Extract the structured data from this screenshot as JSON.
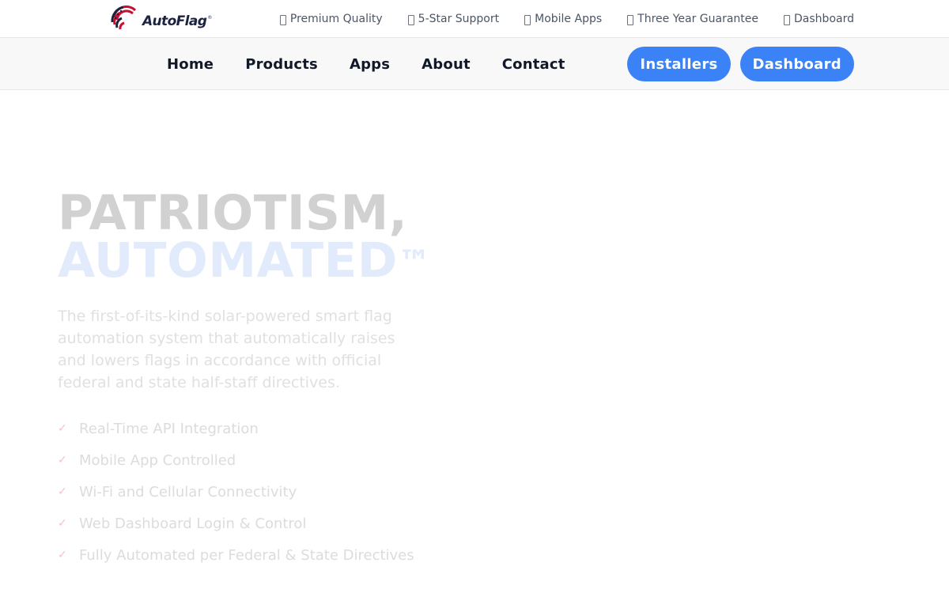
{
  "brand": {
    "name": "AutoFlag",
    "mark": "®"
  },
  "utility_nav": [
    {
      "label": "Premium Quality",
      "icon": "badge-icon"
    },
    {
      "label": "5-Star Support",
      "icon": "headset-icon"
    },
    {
      "label": "Mobile Apps",
      "icon": "phone-icon"
    },
    {
      "label": "Three Year Guarantee",
      "icon": "shield-icon"
    },
    {
      "label": "Dashboard",
      "icon": "dashboard-icon"
    }
  ],
  "main_nav": [
    "Home",
    "Products",
    "Apps",
    "About",
    "Contact"
  ],
  "buttons": {
    "installers": "Installers",
    "dashboard": "Dashboard"
  },
  "hero": {
    "title_line1": "PATRIOTISM,",
    "title_line2": "AUTOMATED",
    "title_tm": "™",
    "description": "The first-of-its-kind solar-powered smart flag automation system that automatically raises and lowers flags in accordance with official federal and state half-staff directives.",
    "check_glyph": "✓",
    "features": [
      "Real-Time API Integration",
      "Mobile App Controlled",
      "Wi-Fi and Cellular Connectivity",
      "Web Dashboard Login & Control",
      "Fully Automated per Federal & State Directives"
    ]
  },
  "colors": {
    "accent": "#3b82f6",
    "title_faded": "#d1d1d1",
    "title_blue_faded": "#e1ebfb",
    "check_faded": "#f6c3c3",
    "nav_bg": "#f8f8f8"
  }
}
